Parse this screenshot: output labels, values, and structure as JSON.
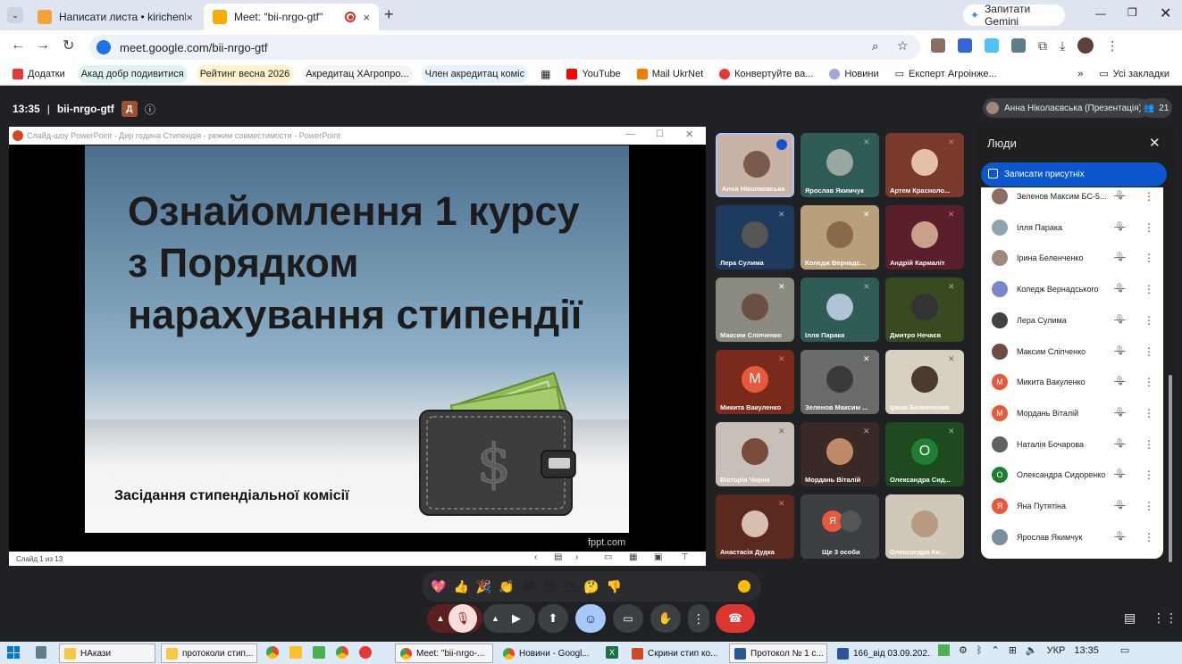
{
  "browser": {
    "tabs": [
      {
        "label": "Написати листа • kirichenko.ol",
        "close": "×"
      },
      {
        "label": "Meet: \"bii-nrgo-gtf\"",
        "close": "×"
      }
    ],
    "new_tab": "+",
    "gemini_button": "Запитати Gemini",
    "url": "meet.google.com/bii-nrgo-gtf",
    "bookmarks": [
      "Додатки",
      "Акад добр подивитися",
      "Рейтинг весна 2026",
      "Акредитац ХАгропро...",
      "Член акредитац коміс",
      "YouTube",
      "Mail UkrNet",
      "Конвертуйте ва...",
      "Новини",
      "Експерт Агроінже..."
    ],
    "all_bookmarks": "Усі закладки"
  },
  "meet": {
    "time": "13:35",
    "separator": "|",
    "code": "bii-nrgo-gtf",
    "host_badge": "Д",
    "presenter_label": "Анна Ніколаєвська (Презентація)",
    "participant_count": "21",
    "ppt": {
      "window_title": "Слайд-шоу PowerPoint - Дир година Стипендія - режим совместимости - PowerPoint",
      "slide_title": "Ознайомлення 1 курсу з Порядком нарахування стипендії",
      "slide_subtitle": "Засідання стипендіальної комісії",
      "watermark": "fppt.com",
      "status": "Слайд 1 из 13"
    },
    "tiles": [
      {
        "name": "Анна Ніколаєвська"
      },
      {
        "name": "Ярослав Якимчук"
      },
      {
        "name": "Артем Красноло..."
      },
      {
        "name": "Лера Сулима"
      },
      {
        "name": "Коледж Вернадс..."
      },
      {
        "name": "Андрій Кармаліт"
      },
      {
        "name": "Максим Сліпченко"
      },
      {
        "name": "Ілля Парака"
      },
      {
        "name": "Дмитро Нечаєв"
      },
      {
        "name": "Микита Вакуленко",
        "letter": "М"
      },
      {
        "name": "Зеленов Максим ..."
      },
      {
        "name": "Ірина Беленченко"
      },
      {
        "name": "Вікторія Чорна"
      },
      {
        "name": "Мордань Віталій"
      },
      {
        "name": "Олександра Сид...",
        "letter": "О"
      },
      {
        "name": "Анастасія Дудка"
      },
      {
        "name": "Ще 3 особи",
        "letter": "Я"
      },
      {
        "name": "Олександра Ки..."
      }
    ],
    "people_panel": {
      "title": "Люди",
      "record_attendance": "Записати присутніх",
      "rows": [
        {
          "name": "Зеленов Максим БС-5..."
        },
        {
          "name": "Ілля Парака"
        },
        {
          "name": "Ірина Беленченко"
        },
        {
          "name": "Коледж Вернадського"
        },
        {
          "name": "Лера Сулима"
        },
        {
          "name": "Максим Сліпченко"
        },
        {
          "name": "Микита Вакуленко",
          "letter": "М"
        },
        {
          "name": "Мордань Віталій",
          "letter": "М"
        },
        {
          "name": "Наталія Бочарова"
        },
        {
          "name": "Олександра Сидоренко",
          "letter": "О"
        },
        {
          "name": "Яна Путятіна",
          "letter": "Я"
        },
        {
          "name": "Ярослав Якимчук"
        }
      ]
    },
    "reactions": [
      "💖",
      "👍",
      "🎉",
      "👏",
      "😂",
      "😮",
      "😢",
      "🤔",
      "👎"
    ]
  },
  "taskbar": {
    "items": [
      "НАкази",
      "протоколи стип...",
      "Meet: \"bii-nrgo-...",
      "Новини - Googl...",
      "Скрини стип ко...",
      "Протокол № 1 с...",
      "166_від 03.09.202..."
    ],
    "lang": "УКР",
    "clock": "13:35"
  },
  "colors": {
    "meet_bg": "#202124",
    "accent_blue": "#0b57d0",
    "end_call_red": "#dc362e",
    "taskbar": "#dce9f7"
  }
}
